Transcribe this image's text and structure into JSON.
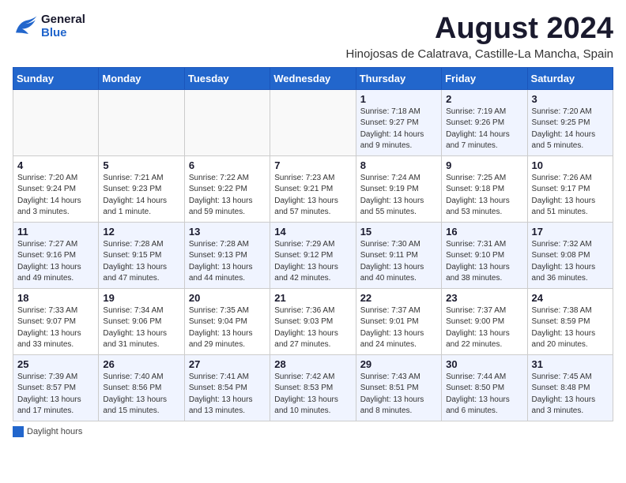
{
  "header": {
    "logo_line1": "General",
    "logo_line2": "Blue",
    "main_title": "August 2024",
    "subtitle": "Hinojosas de Calatrava, Castille-La Mancha, Spain"
  },
  "calendar": {
    "days_of_week": [
      "Sunday",
      "Monday",
      "Tuesday",
      "Wednesday",
      "Thursday",
      "Friday",
      "Saturday"
    ],
    "weeks": [
      [
        {
          "day": "",
          "info": ""
        },
        {
          "day": "",
          "info": ""
        },
        {
          "day": "",
          "info": ""
        },
        {
          "day": "",
          "info": ""
        },
        {
          "day": "1",
          "info": "Sunrise: 7:18 AM\nSunset: 9:27 PM\nDaylight: 14 hours\nand 9 minutes."
        },
        {
          "day": "2",
          "info": "Sunrise: 7:19 AM\nSunset: 9:26 PM\nDaylight: 14 hours\nand 7 minutes."
        },
        {
          "day": "3",
          "info": "Sunrise: 7:20 AM\nSunset: 9:25 PM\nDaylight: 14 hours\nand 5 minutes."
        }
      ],
      [
        {
          "day": "4",
          "info": "Sunrise: 7:20 AM\nSunset: 9:24 PM\nDaylight: 14 hours\nand 3 minutes."
        },
        {
          "day": "5",
          "info": "Sunrise: 7:21 AM\nSunset: 9:23 PM\nDaylight: 14 hours\nand 1 minute."
        },
        {
          "day": "6",
          "info": "Sunrise: 7:22 AM\nSunset: 9:22 PM\nDaylight: 13 hours\nand 59 minutes."
        },
        {
          "day": "7",
          "info": "Sunrise: 7:23 AM\nSunset: 9:21 PM\nDaylight: 13 hours\nand 57 minutes."
        },
        {
          "day": "8",
          "info": "Sunrise: 7:24 AM\nSunset: 9:19 PM\nDaylight: 13 hours\nand 55 minutes."
        },
        {
          "day": "9",
          "info": "Sunrise: 7:25 AM\nSunset: 9:18 PM\nDaylight: 13 hours\nand 53 minutes."
        },
        {
          "day": "10",
          "info": "Sunrise: 7:26 AM\nSunset: 9:17 PM\nDaylight: 13 hours\nand 51 minutes."
        }
      ],
      [
        {
          "day": "11",
          "info": "Sunrise: 7:27 AM\nSunset: 9:16 PM\nDaylight: 13 hours\nand 49 minutes."
        },
        {
          "day": "12",
          "info": "Sunrise: 7:28 AM\nSunset: 9:15 PM\nDaylight: 13 hours\nand 47 minutes."
        },
        {
          "day": "13",
          "info": "Sunrise: 7:28 AM\nSunset: 9:13 PM\nDaylight: 13 hours\nand 44 minutes."
        },
        {
          "day": "14",
          "info": "Sunrise: 7:29 AM\nSunset: 9:12 PM\nDaylight: 13 hours\nand 42 minutes."
        },
        {
          "day": "15",
          "info": "Sunrise: 7:30 AM\nSunset: 9:11 PM\nDaylight: 13 hours\nand 40 minutes."
        },
        {
          "day": "16",
          "info": "Sunrise: 7:31 AM\nSunset: 9:10 PM\nDaylight: 13 hours\nand 38 minutes."
        },
        {
          "day": "17",
          "info": "Sunrise: 7:32 AM\nSunset: 9:08 PM\nDaylight: 13 hours\nand 36 minutes."
        }
      ],
      [
        {
          "day": "18",
          "info": "Sunrise: 7:33 AM\nSunset: 9:07 PM\nDaylight: 13 hours\nand 33 minutes."
        },
        {
          "day": "19",
          "info": "Sunrise: 7:34 AM\nSunset: 9:06 PM\nDaylight: 13 hours\nand 31 minutes."
        },
        {
          "day": "20",
          "info": "Sunrise: 7:35 AM\nSunset: 9:04 PM\nDaylight: 13 hours\nand 29 minutes."
        },
        {
          "day": "21",
          "info": "Sunrise: 7:36 AM\nSunset: 9:03 PM\nDaylight: 13 hours\nand 27 minutes."
        },
        {
          "day": "22",
          "info": "Sunrise: 7:37 AM\nSunset: 9:01 PM\nDaylight: 13 hours\nand 24 minutes."
        },
        {
          "day": "23",
          "info": "Sunrise: 7:37 AM\nSunset: 9:00 PM\nDaylight: 13 hours\nand 22 minutes."
        },
        {
          "day": "24",
          "info": "Sunrise: 7:38 AM\nSunset: 8:59 PM\nDaylight: 13 hours\nand 20 minutes."
        }
      ],
      [
        {
          "day": "25",
          "info": "Sunrise: 7:39 AM\nSunset: 8:57 PM\nDaylight: 13 hours\nand 17 minutes."
        },
        {
          "day": "26",
          "info": "Sunrise: 7:40 AM\nSunset: 8:56 PM\nDaylight: 13 hours\nand 15 minutes."
        },
        {
          "day": "27",
          "info": "Sunrise: 7:41 AM\nSunset: 8:54 PM\nDaylight: 13 hours\nand 13 minutes."
        },
        {
          "day": "28",
          "info": "Sunrise: 7:42 AM\nSunset: 8:53 PM\nDaylight: 13 hours\nand 10 minutes."
        },
        {
          "day": "29",
          "info": "Sunrise: 7:43 AM\nSunset: 8:51 PM\nDaylight: 13 hours\nand 8 minutes."
        },
        {
          "day": "30",
          "info": "Sunrise: 7:44 AM\nSunset: 8:50 PM\nDaylight: 13 hours\nand 6 minutes."
        },
        {
          "day": "31",
          "info": "Sunrise: 7:45 AM\nSunset: 8:48 PM\nDaylight: 13 hours\nand 3 minutes."
        }
      ]
    ]
  },
  "footer": {
    "legend_label": "Daylight hours"
  }
}
